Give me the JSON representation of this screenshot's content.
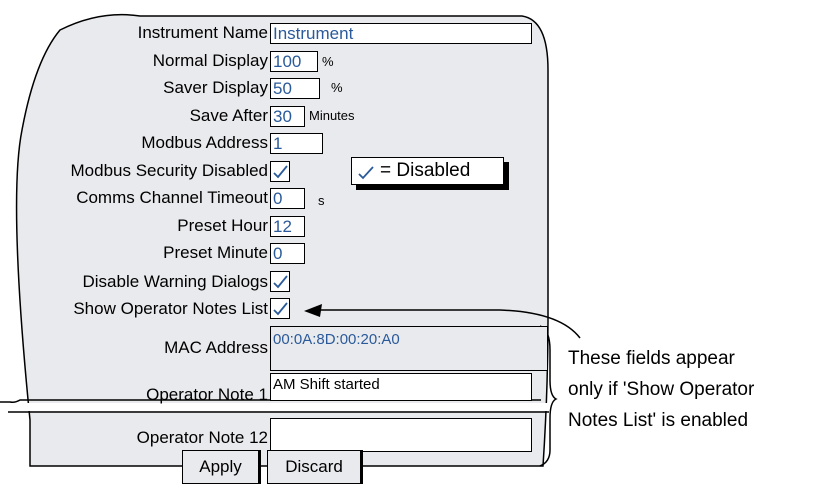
{
  "fields": {
    "instrument_name": {
      "label": "Instrument Name",
      "value": "Instrument"
    },
    "normal_display": {
      "label": "Normal Display",
      "value": "100",
      "unit": "%"
    },
    "saver_display": {
      "label": "Saver Display",
      "value": "50",
      "unit": "%"
    },
    "save_after": {
      "label": "Save After",
      "value": "30",
      "unit": "Minutes"
    },
    "modbus_address": {
      "label": "Modbus Address",
      "value": "1"
    },
    "modbus_security_disabled": {
      "label": "Modbus Security Disabled",
      "checked": true
    },
    "comms_channel_timeout": {
      "label": "Comms Channel Timeout",
      "value": "0",
      "unit": "s"
    },
    "preset_hour": {
      "label": "Preset Hour",
      "value": "12"
    },
    "preset_minute": {
      "label": "Preset Minute",
      "value": "0"
    },
    "disable_warning_dialogs": {
      "label": "Disable Warning Dialogs",
      "checked": true
    },
    "show_operator_notes_list": {
      "label": "Show Operator Notes List",
      "checked": true
    },
    "mac_address": {
      "label": "MAC Address",
      "value": "00:0A:8D:00:20:A0"
    },
    "operator_note_1": {
      "label": "Operator Note 1",
      "value": "AM Shift started"
    },
    "operator_note_12": {
      "label": "Operator Note 12",
      "value": ""
    }
  },
  "legend": {
    "text": "= Disabled",
    "icon": "checkmark-icon"
  },
  "buttons": {
    "apply": "Apply",
    "discard": "Discard"
  },
  "annotation": {
    "lines": [
      "These fields appear",
      "only if 'Show Operator",
      "Notes List' is enabled"
    ]
  },
  "colors": {
    "value_text": "#2a5a9a",
    "panel": "#e9eaed",
    "field_bg": "#ffffff"
  }
}
